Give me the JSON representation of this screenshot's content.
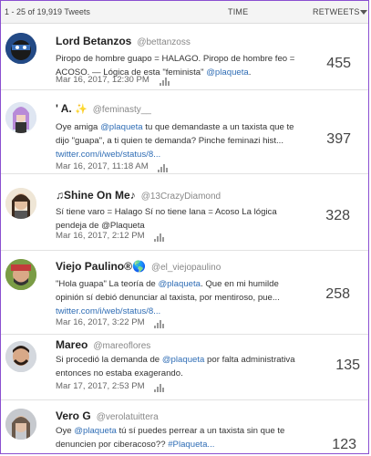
{
  "header": {
    "count": "1 - 25 of 19,919 Tweets",
    "time_label": "TIME",
    "retweets_label": "RETWEETS"
  },
  "tweets": [
    {
      "name": "Lord Betanzos",
      "handle": "@bettanzoss",
      "text_a": "Piropo de hombre guapo = HALAGO. Piropo de hombre feo =",
      "text_b": "ACOSO. — Lógica de esta \"feminista\" ",
      "mention_b": "@plaqueta",
      "text_b2": ".",
      "date": "Mar 16, 2017, 12:30 PM",
      "retweets": "455"
    },
    {
      "name": "' A. ",
      "sparkle": "✨",
      "handle": "@feminasty__",
      "text_a1": "Oye amiga ",
      "mention_a": "@plaqueta",
      "text_a2": " tu que demandaste a un taxista que te",
      "text_b": "dijo \"guapa\", a ti quien te demanda? Pinche feminazi hist...",
      "link": "twitter.com/i/web/status/8...",
      "date": "Mar 16, 2017, 11:18 AM",
      "retweets": "397"
    },
    {
      "name": "♫Shine On Me♪",
      "handle": "@13CrazyDiamond",
      "text_a": "Sí tiene varo = Halago Sí no tiene lana = Acoso La lógica",
      "text_b": "pendeja de @Plaqueta",
      "date": "Mar 16, 2017, 2:12 PM",
      "retweets": "328"
    },
    {
      "name": "Viejo Paulino®",
      "globe": "🌎",
      "handle": "@el_viejopaulino",
      "text_a1": "\"Hola guapa\" La teoría de ",
      "mention_a": "@plaqueta",
      "text_a2": ". Que en mi humilde",
      "text_b": "opinión sí debió denunciar al taxista, por mentiroso, pue...",
      "link": "twitter.com/i/web/status/8...",
      "date": "Mar 16, 2017, 3:22 PM",
      "retweets": "258"
    },
    {
      "name": "Mareo",
      "handle": "@mareoflores",
      "text_a1": "Si procedió la demanda de ",
      "mention_a": "@plaqueta",
      "text_a2": " por falta administrativa",
      "text_b": "entonces no estaba exagerando.",
      "date": "Mar 17, 2017, 2:53 PM",
      "retweets": "135"
    },
    {
      "name": "Vero G",
      "handle": "@verolatuittera",
      "text_a1": "Oye ",
      "mention_a": "@plaqueta",
      "text_a2": " tú sí puedes perrear a un taxista sin que te",
      "text_b1": "denuncien por ciberacoso?? ",
      "hashtag_b": "#Plaqueta...",
      "retweets": "123"
    }
  ]
}
